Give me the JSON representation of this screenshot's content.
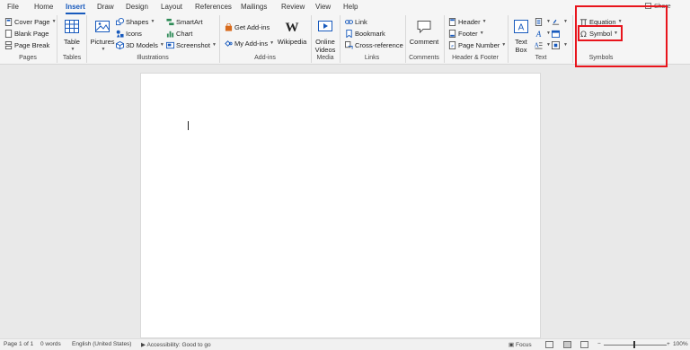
{
  "menu": {
    "tabs": [
      "File",
      "Home",
      "Insert",
      "Draw",
      "Design",
      "Layout",
      "References",
      "Mailings",
      "Review",
      "View",
      "Help"
    ],
    "active_tab": "Insert",
    "share_label": "Share"
  },
  "ribbon": {
    "pages": {
      "label": "Pages",
      "items": [
        "Cover Page",
        "Blank Page",
        "Page Break"
      ]
    },
    "tables": {
      "label": "Tables",
      "table_label": "Table"
    },
    "illustrations": {
      "label": "Illustrations",
      "pictures_label": "Pictures",
      "col1": [
        "Shapes",
        "Icons",
        "3D Models"
      ],
      "col2": [
        "SmartArt",
        "Chart",
        "Screenshot"
      ]
    },
    "addins": {
      "label": "Add-ins",
      "get_addins": "Get Add-ins",
      "my_addins": "My Add-ins",
      "wikipedia": "Wikipedia"
    },
    "media": {
      "label": "Media",
      "online_videos_line1": "Online",
      "online_videos_line2": "Videos"
    },
    "links": {
      "label": "Links",
      "items": [
        "Link",
        "Bookmark",
        "Cross-reference"
      ]
    },
    "comments": {
      "label": "Comments",
      "comment_label": "Comment"
    },
    "header_footer": {
      "label": "Header & Footer",
      "items": [
        "Header",
        "Footer",
        "Page Number"
      ]
    },
    "text": {
      "label": "Text",
      "textbox_line1": "Text",
      "textbox_line2": "Box"
    },
    "symbols": {
      "label": "Symbols",
      "equation": "Equation",
      "symbol": "Symbol"
    }
  },
  "status": {
    "page": "Page 1 of 1",
    "words": "0 words",
    "language": "English (United States)",
    "accessibility": "Accessibility: Good to go",
    "focus": "Focus",
    "zoom": "100%"
  },
  "icons": {
    "cover_page": "cover-page-icon",
    "blank_page": "blank-page-icon",
    "page_break": "page-break-icon",
    "table": "table-icon",
    "pictures": "pictures-icon",
    "shapes": "shapes-icon",
    "icons": "icons-icon",
    "models": "3d-models-icon",
    "smartart": "smartart-icon",
    "chart": "chart-icon",
    "screenshot": "screenshot-icon",
    "get_addins": "store-icon",
    "my_addins": "addins-icon",
    "wikipedia": "wikipedia-icon",
    "online_videos": "video-icon",
    "link": "link-icon",
    "bookmark": "bookmark-icon",
    "cross_reference": "cross-reference-icon",
    "comment": "comment-icon",
    "header": "header-icon",
    "footer": "footer-icon",
    "page_number": "page-number-icon",
    "textbox": "text-box-icon",
    "equation": "equation-icon",
    "symbol": "omega-icon"
  },
  "colors": {
    "accent": "#185abd",
    "annotation": "#e8141c",
    "green_icon": "#2e8b57",
    "orange_icon": "#d86a1c"
  }
}
